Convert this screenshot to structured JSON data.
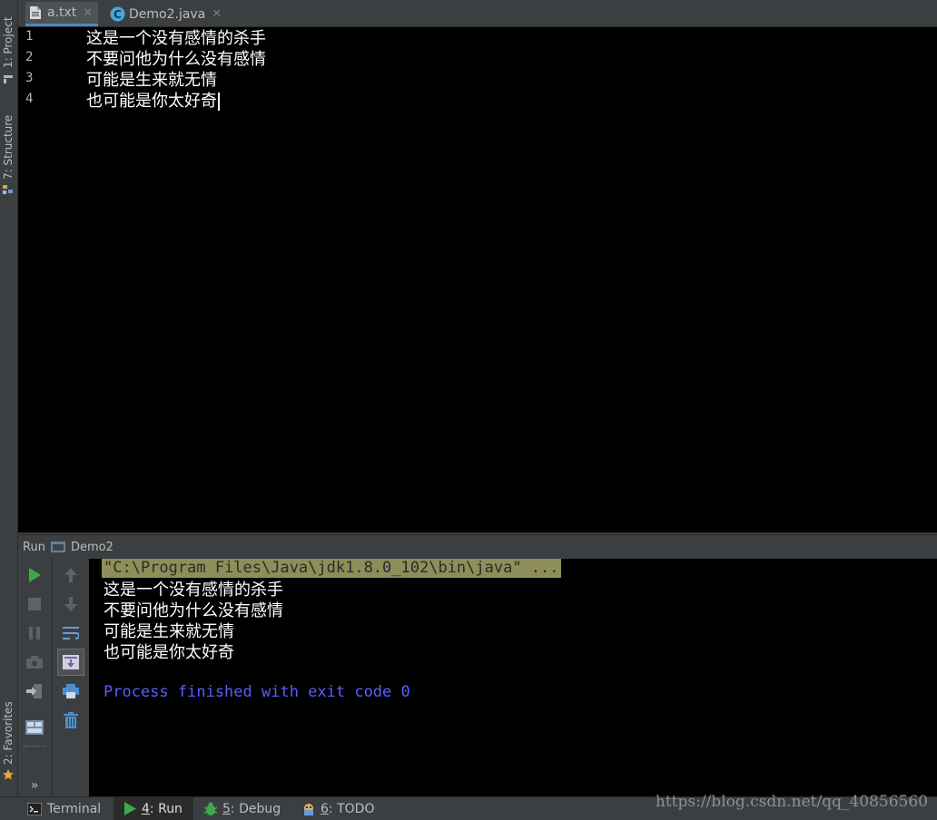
{
  "left_tools": {
    "project": "1: Project",
    "structure": "7: Structure",
    "favorites": "2: Favorites"
  },
  "tabs": [
    {
      "label": "a.txt",
      "icon": "text-file-icon",
      "active": true
    },
    {
      "label": "Demo2.java",
      "icon": "java-class-icon",
      "active": false
    }
  ],
  "editor": {
    "line_numbers": [
      "1",
      "2",
      "3",
      "4"
    ],
    "lines": [
      "这是一个没有感情的杀手",
      "不要问他为什么没有感情",
      "可能是生来就无情",
      "也可能是你太好奇"
    ]
  },
  "run": {
    "tool_label": "Run",
    "config_name": "Demo2",
    "command": "\"C:\\Program Files\\Java\\jdk1.8.0_102\\bin\\java\" ...",
    "output": [
      "这是一个没有感情的杀手",
      "不要问他为什么没有感情",
      "可能是生来就无情",
      "也可能是你太好奇"
    ],
    "finish_message": "Process finished with exit code 0"
  },
  "status": {
    "terminal": "Terminal",
    "run_num": "4",
    "run_label": ": Run",
    "debug_num": "5",
    "debug_label": ": Debug",
    "todo_num": "6",
    "todo_label": ": TODO",
    "watermark": "https://blog.csdn.net/qq_40856560"
  },
  "colors": {
    "editor_bg": "#000000",
    "ide_bg": "#3c3f41",
    "command_highlight": "#8e8e5a",
    "finish_text": "#5c5cff",
    "run_green": "#3fa84a"
  }
}
